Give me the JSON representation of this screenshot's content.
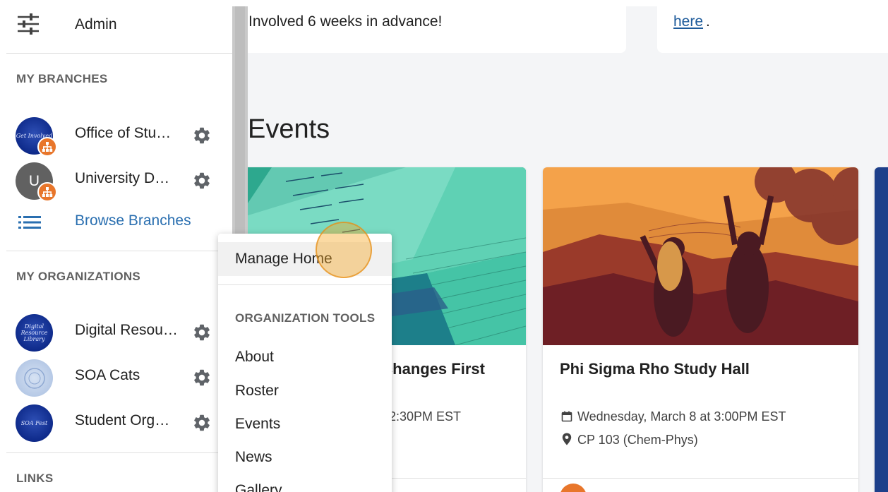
{
  "sidebar": {
    "admin_label": "Admin",
    "my_branches_title": "MY BRANCHES",
    "branches": [
      {
        "label": "Office of Stu…",
        "avatar_text": "Get Involved"
      },
      {
        "label": "University D…",
        "avatar_text": "U"
      }
    ],
    "browse_branches": "Browse Branches",
    "my_orgs_title": "MY ORGANIZATIONS",
    "organizations": [
      {
        "label": "Digital Resou…",
        "avatar_text": "Digital Resource Library"
      },
      {
        "label": "SOA Cats"
      },
      {
        "label": "Student Org…",
        "avatar_text": "SOA Fest"
      }
    ],
    "links_title": "LINKS"
  },
  "top_cards": {
    "card1_text": "Involved 6 weeks in advance!",
    "card2_link": "here",
    "card2_punct": "."
  },
  "events": {
    "heading": "Events",
    "cards": [
      {
        "title_partial": "Exchanges First",
        "time_partial": "2:30PM EST"
      },
      {
        "title": "Phi Sigma Rho Study Hall",
        "datetime": "Wednesday, March 8 at 3:00PM EST",
        "location": "CP 103 (Chem-Phys)"
      }
    ]
  },
  "menu": {
    "manage_home": "Manage Home",
    "section_title": "ORGANIZATION TOOLS",
    "items": [
      "About",
      "Roster",
      "Events",
      "News",
      "Gallery"
    ]
  },
  "colors": {
    "link_blue": "#2a6fb0",
    "badge_orange": "#e8762b",
    "navy": "#0e2a8a"
  },
  "icons": [
    "admin-sliders-icon",
    "settings-gear-icon",
    "hierarchy-icon",
    "list-icon",
    "calendar-icon",
    "location-pin-icon"
  ]
}
